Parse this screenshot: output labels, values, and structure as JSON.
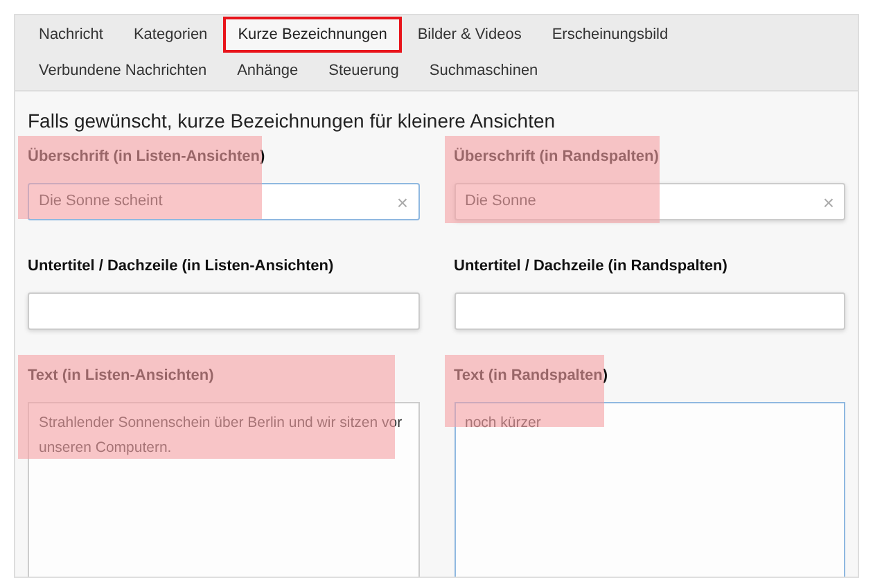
{
  "tabs": [
    {
      "label": "Nachricht",
      "selected": false
    },
    {
      "label": "Kategorien",
      "selected": false
    },
    {
      "label": "Kurze Bezeichnungen",
      "selected": true
    },
    {
      "label": "Bilder & Videos",
      "selected": false
    },
    {
      "label": "Erscheinungsbild",
      "selected": false
    },
    {
      "label": "Verbundene Nachrichten",
      "selected": false
    },
    {
      "label": "Anhänge",
      "selected": false
    },
    {
      "label": "Steuerung",
      "selected": false
    },
    {
      "label": "Suchmaschinen",
      "selected": false
    }
  ],
  "heading": "Falls gewünscht, kurze Bezeichnungen für kleinere Ansichten",
  "fields": [
    {
      "label": "Überschrift (in Listen-Ansichten)",
      "kind": "input",
      "value": "Die Sonne scheint",
      "clear_icon": "×",
      "focused": true,
      "highlighted": true
    },
    {
      "label": "Überschrift (in Randspalten)",
      "kind": "input",
      "value": "Die Sonne",
      "clear_icon": "×",
      "focused": false,
      "highlighted": true
    },
    {
      "label": "Untertitel / Dachzeile (in Listen-Ansichten)",
      "kind": "input",
      "focused": false,
      "highlighted": false
    },
    {
      "label": "Untertitel / Dachzeile (in Randspalten)",
      "kind": "input",
      "focused": false,
      "highlighted": false
    },
    {
      "label": "Text (in Listen-Ansichten)",
      "kind": "textarea",
      "value": "Strahlender Sonnenschein über Berlin und wir sitzen vor unseren Computern.",
      "focused": false,
      "highlighted": true
    },
    {
      "label": "Text (in Randspalten)",
      "kind": "textarea",
      "value": "noch kürzer",
      "focused": true,
      "highlighted": true
    }
  ]
}
